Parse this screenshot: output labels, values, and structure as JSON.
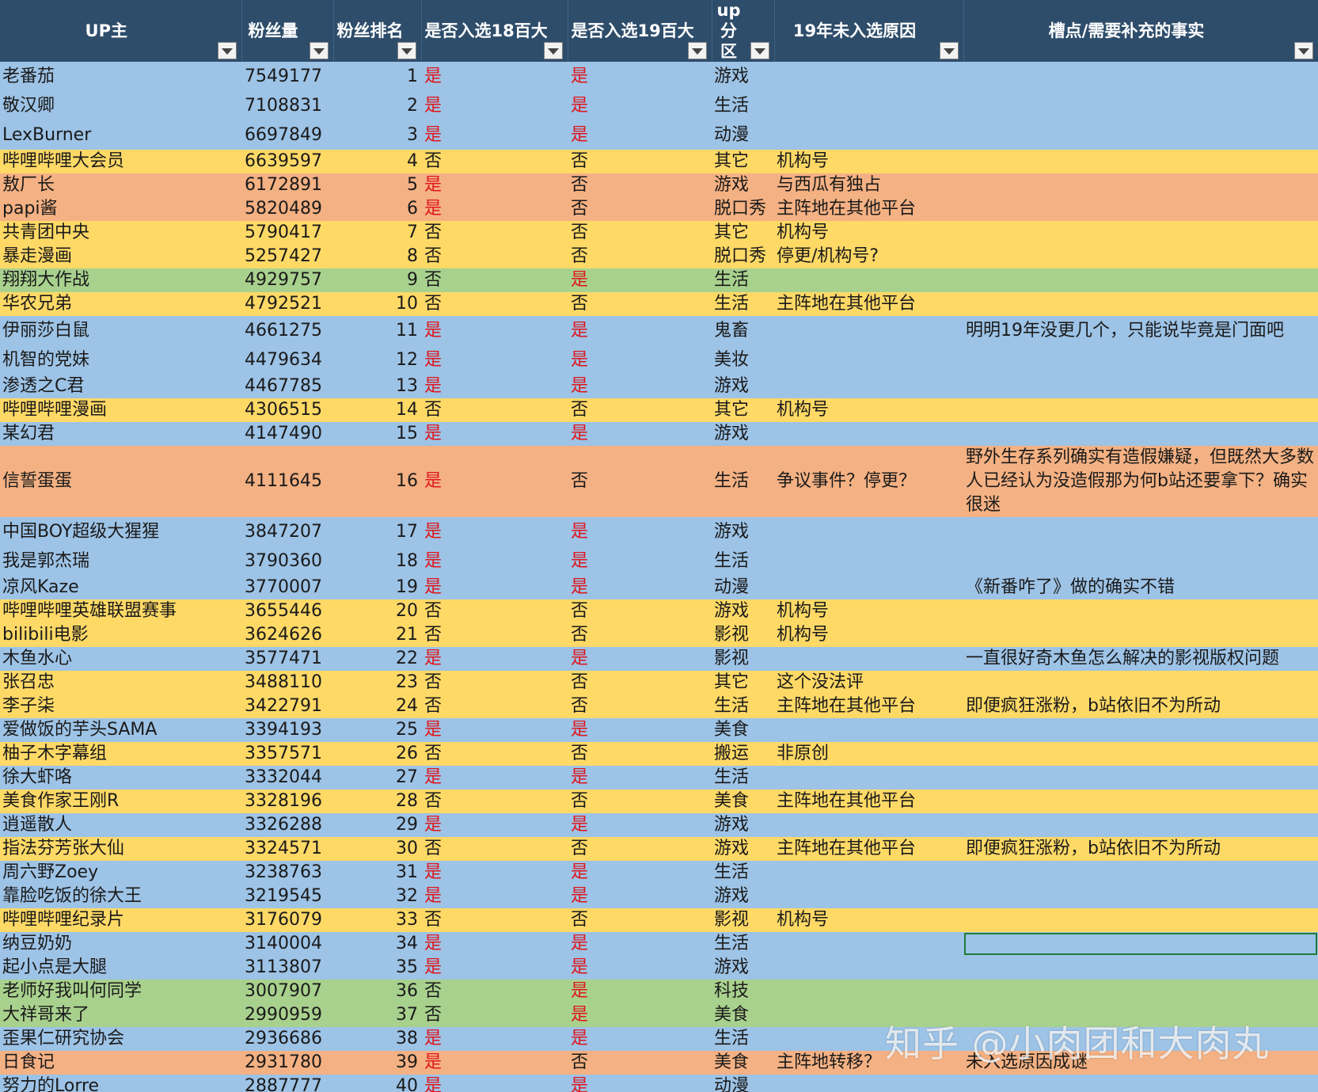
{
  "headers": [
    "UP主",
    "粉丝量",
    "粉丝排名",
    "是否入选18百大",
    "是否入选19百大",
    "up分区",
    "19年未入选原因",
    "槽点/需要补充的事实"
  ],
  "colors": {
    "header_bg": "#2e4d6b",
    "blue": "#9dc3e6",
    "yellow": "#ffd966",
    "orange": "#f4b183",
    "green": "#a9d18e",
    "yes_text": "#e0161b"
  },
  "icons": {
    "filter": "filter-dropdown-icon"
  },
  "rows": [
    {
      "name": "老番茄",
      "fans": "7549177",
      "rank": "1",
      "y18": "是",
      "y19": "是",
      "zone": "游戏",
      "reason": "",
      "note": "",
      "color": "blue",
      "h": "h37"
    },
    {
      "name": "敬汉卿",
      "fans": "7108831",
      "rank": "2",
      "y18": "是",
      "y19": "是",
      "zone": "生活",
      "reason": "",
      "note": "",
      "color": "blue",
      "h": "h37"
    },
    {
      "name": "LexBurner",
      "fans": "6697849",
      "rank": "3",
      "y18": "是",
      "y19": "是",
      "zone": "动漫",
      "reason": "",
      "note": "",
      "color": "blue",
      "h": "h37"
    },
    {
      "name": "哔哩哔哩大会员",
      "fans": "6639597",
      "rank": "4",
      "y18": "否",
      "y19": "否",
      "zone": "其它",
      "reason": "机构号",
      "note": "",
      "color": "yellow",
      "h": "h30"
    },
    {
      "name": "敖厂长",
      "fans": "6172891",
      "rank": "5",
      "y18": "是",
      "y19": "否",
      "zone": "游戏",
      "reason": "与西瓜有独占",
      "note": "",
      "color": "orange",
      "h": "h30"
    },
    {
      "name": "papi酱",
      "fans": "5820489",
      "rank": "6",
      "y18": "是",
      "y19": "否",
      "zone": "脱口秀",
      "reason": "主阵地在其他平台",
      "note": "",
      "color": "orange",
      "h": "h30"
    },
    {
      "name": "共青团中央",
      "fans": "5790417",
      "rank": "7",
      "y18": "否",
      "y19": "否",
      "zone": "其它",
      "reason": "机构号",
      "note": "",
      "color": "yellow",
      "h": "h30"
    },
    {
      "name": "暴走漫画",
      "fans": "5257427",
      "rank": "8",
      "y18": "否",
      "y19": "否",
      "zone": "脱口秀",
      "reason": "停更/机构号?",
      "note": "",
      "color": "yellow",
      "h": "h30"
    },
    {
      "name": "翔翔大作战",
      "fans": "4929757",
      "rank": "9",
      "y18": "否",
      "y19": "是",
      "zone": "生活",
      "reason": "",
      "note": "",
      "color": "green",
      "h": "h30"
    },
    {
      "name": "华农兄弟",
      "fans": "4792521",
      "rank": "10",
      "y18": "否",
      "y19": "否",
      "zone": "生活",
      "reason": "主阵地在其他平台",
      "note": "",
      "color": "yellow",
      "h": "h30"
    },
    {
      "name": "伊丽莎白鼠",
      "fans": "4661275",
      "rank": "11",
      "y18": "是",
      "y19": "是",
      "zone": "鬼畜",
      "reason": "",
      "note": "明明19年没更几个，只能说毕竟是门面吧",
      "color": "blue",
      "h": "h37"
    },
    {
      "name": "机智的党妹",
      "fans": "4479634",
      "rank": "12",
      "y18": "是",
      "y19": "是",
      "zone": "美妆",
      "reason": "",
      "note": "",
      "color": "blue",
      "h": "h37"
    },
    {
      "name": "渗透之C君",
      "fans": "4467785",
      "rank": "13",
      "y18": "是",
      "y19": "是",
      "zone": "游戏",
      "reason": "",
      "note": "",
      "color": "blue",
      "h": "h30"
    },
    {
      "name": "哔哩哔哩漫画",
      "fans": "4306515",
      "rank": "14",
      "y18": "否",
      "y19": "否",
      "zone": "其它",
      "reason": "机构号",
      "note": "",
      "color": "yellow",
      "h": "h30"
    },
    {
      "name": "某幻君",
      "fans": "4147490",
      "rank": "15",
      "y18": "是",
      "y19": "是",
      "zone": "游戏",
      "reason": "",
      "note": "",
      "color": "blue",
      "h": "h30"
    },
    {
      "name": "信誓蛋蛋",
      "fans": "4111645",
      "rank": "16",
      "y18": "是",
      "y19": "否",
      "zone": "生活",
      "reason": "争议事件？停更？",
      "note": "野外生存系列确实有造假嫌疑，但既然大多数人已经认为没造假那为何b站还要拿下？确实很迷",
      "color": "orange",
      "h": "h88"
    },
    {
      "name": "中国BOY超级大猩猩",
      "fans": "3847207",
      "rank": "17",
      "y18": "是",
      "y19": "是",
      "zone": "游戏",
      "reason": "",
      "note": "",
      "color": "blue",
      "h": "h37"
    },
    {
      "name": "我是郭杰瑞",
      "fans": "3790360",
      "rank": "18",
      "y18": "是",
      "y19": "是",
      "zone": "生活",
      "reason": "",
      "note": "",
      "color": "blue",
      "h": "h37"
    },
    {
      "name": "凉风Kaze",
      "fans": "3770007",
      "rank": "19",
      "y18": "是",
      "y19": "是",
      "zone": "动漫",
      "reason": "",
      "note": "《新番咋了》做的确实不错",
      "color": "blue",
      "h": "h30"
    },
    {
      "name": "哔哩哔哩英雄联盟赛事",
      "fans": "3655446",
      "rank": "20",
      "y18": "否",
      "y19": "否",
      "zone": "游戏",
      "reason": "机构号",
      "note": "",
      "color": "yellow",
      "h": "h30"
    },
    {
      "name": "bilibili电影",
      "fans": "3624626",
      "rank": "21",
      "y18": "否",
      "y19": "否",
      "zone": "影视",
      "reason": "机构号",
      "note": "",
      "color": "yellow",
      "h": "h30"
    },
    {
      "name": "木鱼水心",
      "fans": "3577471",
      "rank": "22",
      "y18": "是",
      "y19": "是",
      "zone": "影视",
      "reason": "",
      "note": "一直很好奇木鱼怎么解决的影视版权问题",
      "color": "blue",
      "h": "h30"
    },
    {
      "name": "张召忠",
      "fans": "3488110",
      "rank": "23",
      "y18": "否",
      "y19": "否",
      "zone": "其它",
      "reason": "这个没法评",
      "note": "",
      "color": "yellow",
      "h": "h30"
    },
    {
      "name": "李子柒",
      "fans": "3422791",
      "rank": "24",
      "y18": "否",
      "y19": "否",
      "zone": "生活",
      "reason": "主阵地在其他平台",
      "note": "即便疯狂涨粉，b站依旧不为所动",
      "color": "yellow",
      "h": "h30"
    },
    {
      "name": "爱做饭的芋头SAMA",
      "fans": "3394193",
      "rank": "25",
      "y18": "是",
      "y19": "是",
      "zone": "美食",
      "reason": "",
      "note": "",
      "color": "blue",
      "h": "h30"
    },
    {
      "name": "柚子木字幕组",
      "fans": "3357571",
      "rank": "26",
      "y18": "否",
      "y19": "否",
      "zone": "搬运",
      "reason": "非原创",
      "note": "",
      "color": "yellow",
      "h": "h30"
    },
    {
      "name": "徐大虾咯",
      "fans": "3332044",
      "rank": "27",
      "y18": "是",
      "y19": "是",
      "zone": "生活",
      "reason": "",
      "note": "",
      "color": "blue",
      "h": "h30"
    },
    {
      "name": "美食作家王刚R",
      "fans": "3328196",
      "rank": "28",
      "y18": "否",
      "y19": "否",
      "zone": "美食",
      "reason": "主阵地在其他平台",
      "note": "",
      "color": "yellow",
      "h": "h30"
    },
    {
      "name": "逍遥散人",
      "fans": "3326288",
      "rank": "29",
      "y18": "是",
      "y19": "是",
      "zone": "游戏",
      "reason": "",
      "note": "",
      "color": "blue",
      "h": "h30"
    },
    {
      "name": "指法芬芳张大仙",
      "fans": "3324571",
      "rank": "30",
      "y18": "否",
      "y19": "否",
      "zone": "游戏",
      "reason": "主阵地在其他平台",
      "note": "即便疯狂涨粉，b站依旧不为所动",
      "color": "yellow",
      "h": "h30"
    },
    {
      "name": "周六野Zoey",
      "fans": "3238763",
      "rank": "31",
      "y18": "是",
      "y19": "是",
      "zone": "生活",
      "reason": "",
      "note": "",
      "color": "blue",
      "h": "h30"
    },
    {
      "name": "靠脸吃饭的徐大王",
      "fans": "3219545",
      "rank": "32",
      "y18": "是",
      "y19": "是",
      "zone": "游戏",
      "reason": "",
      "note": "",
      "color": "blue",
      "h": "h30"
    },
    {
      "name": "哔哩哔哩纪录片",
      "fans": "3176079",
      "rank": "33",
      "y18": "否",
      "y19": "否",
      "zone": "影视",
      "reason": "机构号",
      "note": "",
      "color": "yellow",
      "h": "h30"
    },
    {
      "name": "纳豆奶奶",
      "fans": "3140004",
      "rank": "34",
      "y18": "是",
      "y19": "是",
      "zone": "生活",
      "reason": "",
      "note": "",
      "color": "blue",
      "h": "h30",
      "selected": true
    },
    {
      "name": "起小点是大腿",
      "fans": "3113807",
      "rank": "35",
      "y18": "是",
      "y19": "是",
      "zone": "游戏",
      "reason": "",
      "note": "",
      "color": "blue",
      "h": "h30"
    },
    {
      "name": "老师好我叫何同学",
      "fans": "3007907",
      "rank": "36",
      "y18": "否",
      "y19": "是",
      "zone": "科技",
      "reason": "",
      "note": "",
      "color": "green",
      "h": "h30"
    },
    {
      "name": "大祥哥来了",
      "fans": "2990959",
      "rank": "37",
      "y18": "否",
      "y19": "是",
      "zone": "美食",
      "reason": "",
      "note": "",
      "color": "green",
      "h": "h30"
    },
    {
      "name": "歪果仁研究协会",
      "fans": "2936686",
      "rank": "38",
      "y18": "是",
      "y19": "是",
      "zone": "生活",
      "reason": "",
      "note": "",
      "color": "blue",
      "h": "h30"
    },
    {
      "name": "日食记",
      "fans": "2931780",
      "rank": "39",
      "y18": "是",
      "y19": "否",
      "zone": "美食",
      "reason": "主阵地转移？",
      "note": "未入选原因成谜",
      "color": "orange",
      "h": "h30"
    },
    {
      "name": "努力的Lorre",
      "fans": "2887777",
      "rank": "40",
      "y18": "是",
      "y19": "是",
      "zone": "动漫",
      "reason": "",
      "note": "",
      "color": "blue",
      "h": "h30"
    }
  ],
  "watermark": "知乎 @小肉团和大肉丸"
}
